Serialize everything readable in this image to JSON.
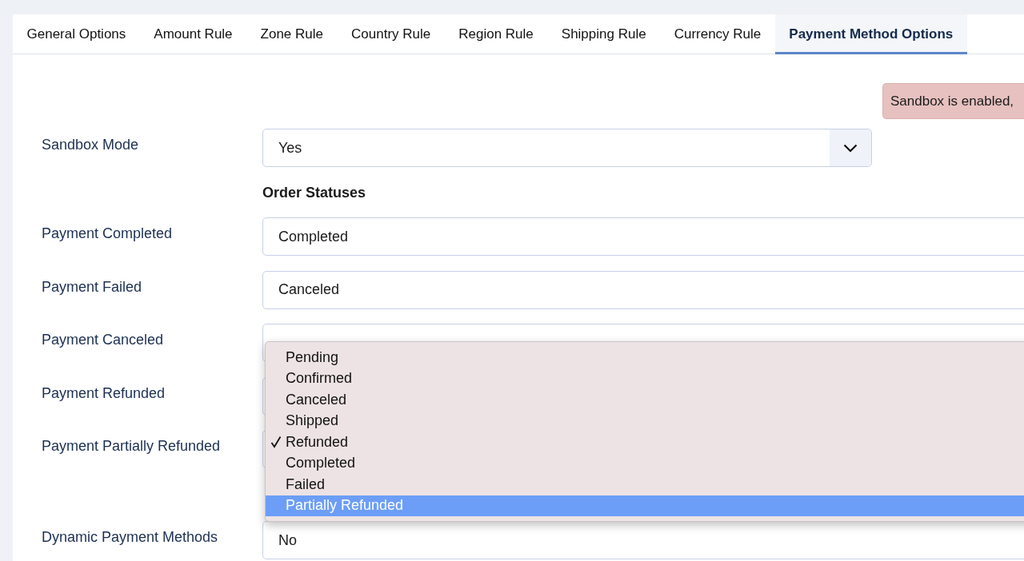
{
  "tabs": [
    {
      "label": "General Options",
      "selected": false
    },
    {
      "label": "Amount Rule",
      "selected": false
    },
    {
      "label": "Zone Rule",
      "selected": false
    },
    {
      "label": "Country Rule",
      "selected": false
    },
    {
      "label": "Region Rule",
      "selected": false
    },
    {
      "label": "Shipping Rule",
      "selected": false
    },
    {
      "label": "Currency Rule",
      "selected": false
    },
    {
      "label": "Payment Method Options",
      "selected": true
    }
  ],
  "alert": {
    "text": "Sandbox is enabled,"
  },
  "sandbox_mode": {
    "label": "Sandbox Mode",
    "value": "Yes"
  },
  "order_statuses": {
    "heading": "Order Statuses",
    "rows": [
      {
        "label": "Payment Completed",
        "value": "Completed"
      },
      {
        "label": "Payment Failed",
        "value": "Canceled"
      },
      {
        "label": "Payment Canceled"
      },
      {
        "label": "Payment Refunded"
      },
      {
        "label": "Payment Partially Refunded"
      }
    ]
  },
  "dynamic_payment_methods": {
    "label": "Dynamic Payment Methods",
    "value": "No"
  },
  "dropdown": {
    "options": [
      {
        "label": "Pending",
        "selected": false,
        "highlighted": false
      },
      {
        "label": "Confirmed",
        "selected": false,
        "highlighted": false
      },
      {
        "label": "Canceled",
        "selected": false,
        "highlighted": false
      },
      {
        "label": "Shipped",
        "selected": false,
        "highlighted": false
      },
      {
        "label": "Refunded",
        "selected": true,
        "highlighted": false
      },
      {
        "label": "Completed",
        "selected": false,
        "highlighted": false
      },
      {
        "label": "Failed",
        "selected": false,
        "highlighted": false
      },
      {
        "label": "Partially Refunded",
        "selected": false,
        "highlighted": true
      }
    ]
  }
}
